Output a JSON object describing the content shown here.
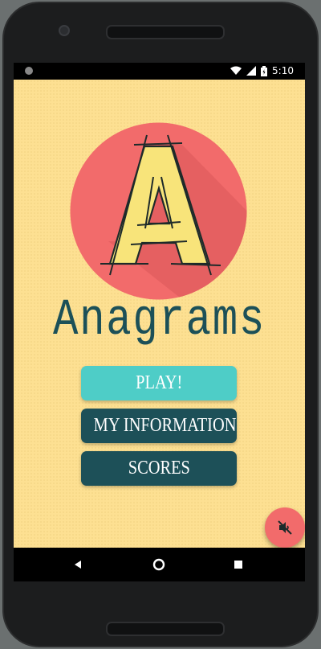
{
  "status_bar": {
    "time": "5:10"
  },
  "app": {
    "title": "Anagrams",
    "logo_letter": "A",
    "buttons": {
      "play": "PLAY!",
      "my_information": "MY INFORMATION",
      "scores": "SCORES"
    },
    "sound_toggle": {
      "icon": "volume-off-icon",
      "state": "muted"
    }
  },
  "colors": {
    "background": "#fde092",
    "logo_circle": "#f26b6b",
    "logo_letter": "#f8e47a",
    "title": "#1c5058",
    "play_button": "#4ecdc7",
    "secondary_button": "#1d5058",
    "fab": "#f26b6b"
  },
  "nav_bar": {
    "icons": [
      "back-icon",
      "home-icon",
      "recents-icon"
    ]
  }
}
